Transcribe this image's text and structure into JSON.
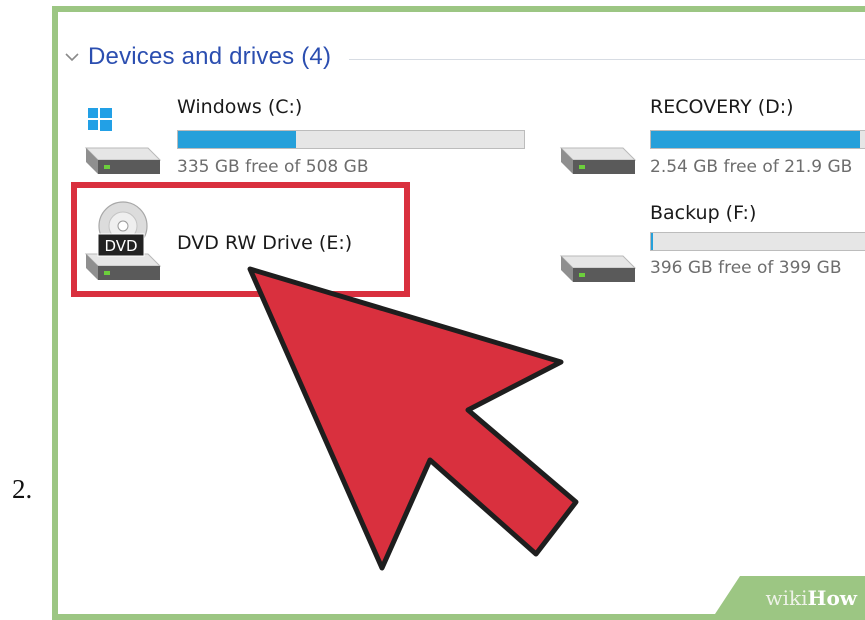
{
  "step": {
    "number": "2."
  },
  "section": {
    "title": "Devices and drives (4)"
  },
  "drives": [
    {
      "name": "Windows (C:)",
      "space": "335 GB free of 508 GB",
      "usage": 0.34,
      "icon": "windows-hard-drive-icon"
    },
    {
      "name": "RECOVERY (D:)",
      "space": "2.54 GB free of 21.9 GB",
      "usage": 0.88,
      "icon": "hard-drive-icon"
    },
    {
      "name": "DVD RW Drive (E:)",
      "icon": "dvd-drive-icon",
      "icon_label": "DVD"
    },
    {
      "name": "Backup (F:)",
      "space": "396 GB free of 399 GB",
      "usage": 0.01,
      "icon": "hard-drive-icon"
    }
  ],
  "annotation": {
    "highlight_color": "#d9303e",
    "arrow_color": "#d9303e"
  },
  "watermark": {
    "wiki": "wiki",
    "how": "How"
  },
  "colors": {
    "frame": "#9cc683",
    "accent": "#2b4eb0",
    "bar_fill": "#26a0da"
  }
}
